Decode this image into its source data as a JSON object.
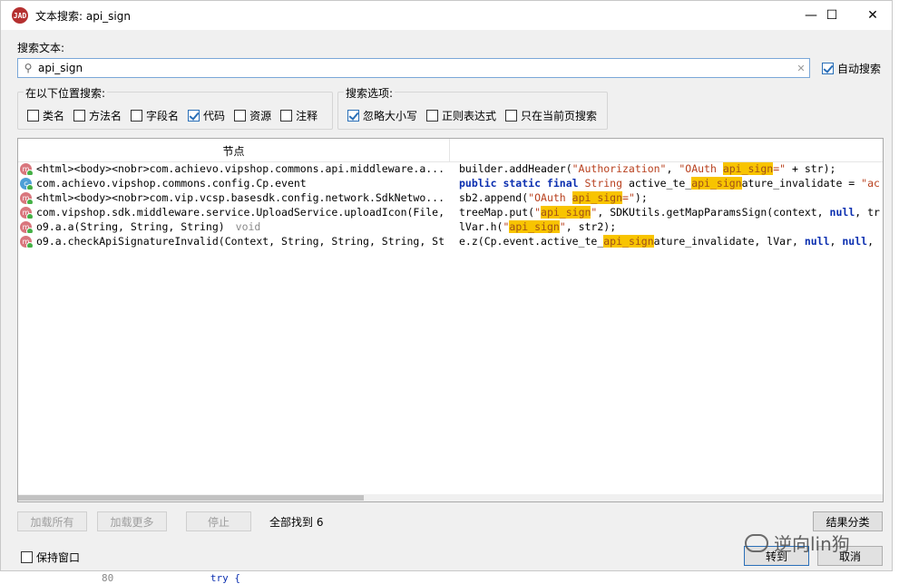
{
  "window": {
    "title": "文本搜索: api_sign",
    "icon": "app-icon"
  },
  "search": {
    "label": "搜索文本:",
    "value": "api_sign",
    "auto_search_label": "自动搜索",
    "auto_search_checked": true
  },
  "locations": {
    "legend": "在以下位置搜索:",
    "options": [
      {
        "label": "类名",
        "checked": false
      },
      {
        "label": "方法名",
        "checked": false
      },
      {
        "label": "字段名",
        "checked": false
      },
      {
        "label": "代码",
        "checked": true
      },
      {
        "label": "资源",
        "checked": false
      },
      {
        "label": "注释",
        "checked": false
      }
    ]
  },
  "search_options": {
    "legend": "搜索选项:",
    "options": [
      {
        "label": "忽略大小写",
        "checked": true
      },
      {
        "label": "正则表达式",
        "checked": false
      },
      {
        "label": "只在当前页搜索",
        "checked": false
      }
    ]
  },
  "results": {
    "column_node": "节点",
    "rows": [
      {
        "icon": "m",
        "node": "<html><body><nobr>com.achievo.vipshop.commons.api.middleware.a...",
        "node_suffix": "",
        "code_segments": [
          {
            "t": "builder.addHeader(",
            "c": ""
          },
          {
            "t": "\"Authorization\"",
            "c": "str"
          },
          {
            "t": ", ",
            "c": ""
          },
          {
            "t": "\"OAuth ",
            "c": "str"
          },
          {
            "t": "api_sign",
            "c": "hl"
          },
          {
            "t": "=\"",
            "c": "str"
          },
          {
            "t": " + str);",
            "c": ""
          }
        ]
      },
      {
        "icon": "c",
        "node": "com.achievo.vipshop.commons.config.Cp.event",
        "node_suffix": "",
        "code_segments": [
          {
            "t": "public static final ",
            "c": "kw"
          },
          {
            "t": "String",
            "c": "str"
          },
          {
            "t": " active_te_",
            "c": ""
          },
          {
            "t": "api_sign",
            "c": "hl"
          },
          {
            "t": "ature_invalidate = ",
            "c": ""
          },
          {
            "t": "\"ac",
            "c": "str"
          }
        ]
      },
      {
        "icon": "m",
        "node": "<html><body><nobr>com.vip.vcsp.basesdk.config.network.SdkNetwo...",
        "node_suffix": "",
        "code_segments": [
          {
            "t": "sb2.append(",
            "c": ""
          },
          {
            "t": "\"OAuth ",
            "c": "str"
          },
          {
            "t": "api_sign",
            "c": "hl"
          },
          {
            "t": "=\"",
            "c": "str"
          },
          {
            "t": ");",
            "c": ""
          }
        ]
      },
      {
        "icon": "m",
        "node": "com.vipshop.sdk.middleware.service.UploadService.uploadIcon(File,",
        "node_suffix": "",
        "code_segments": [
          {
            "t": "treeMap.put(",
            "c": ""
          },
          {
            "t": "\"",
            "c": "str"
          },
          {
            "t": "api_sign",
            "c": "hl"
          },
          {
            "t": "\"",
            "c": "str"
          },
          {
            "t": ", SDKUtils.getMapParamsSign(context, ",
            "c": ""
          },
          {
            "t": "null",
            "c": "kw"
          },
          {
            "t": ", tr",
            "c": ""
          }
        ]
      },
      {
        "icon": "m",
        "node": "o9.a.a(String, String, String) ",
        "node_suffix": "void",
        "code_segments": [
          {
            "t": "lVar.h(",
            "c": ""
          },
          {
            "t": "\"",
            "c": "str"
          },
          {
            "t": "api_sign",
            "c": "hl"
          },
          {
            "t": "\"",
            "c": "str"
          },
          {
            "t": ", str2);",
            "c": ""
          }
        ]
      },
      {
        "icon": "m",
        "node": "o9.a.checkApiSignatureInvalid(Context, String, String, String, St",
        "node_suffix": "",
        "code_segments": [
          {
            "t": "e.z(Cp.event.active_te_",
            "c": ""
          },
          {
            "t": "api_sign",
            "c": "hl"
          },
          {
            "t": "ature_invalidate, lVar, ",
            "c": ""
          },
          {
            "t": "null",
            "c": "kw"
          },
          {
            "t": ", ",
            "c": ""
          },
          {
            "t": "null",
            "c": "kw"
          },
          {
            "t": ",",
            "c": ""
          }
        ]
      }
    ]
  },
  "footer": {
    "load_all": "加载所有",
    "load_more": "加载更多",
    "stop": "停止",
    "found_text": "全部找到 6",
    "group_results": "结果分类",
    "keep_window": "保持窗口",
    "keep_window_checked": false,
    "goto": "转到",
    "cancel": "取消"
  },
  "watermark": {
    "text": "逆向lin狗"
  },
  "background_code": {
    "line_number": "80",
    "keyword": "try {"
  }
}
